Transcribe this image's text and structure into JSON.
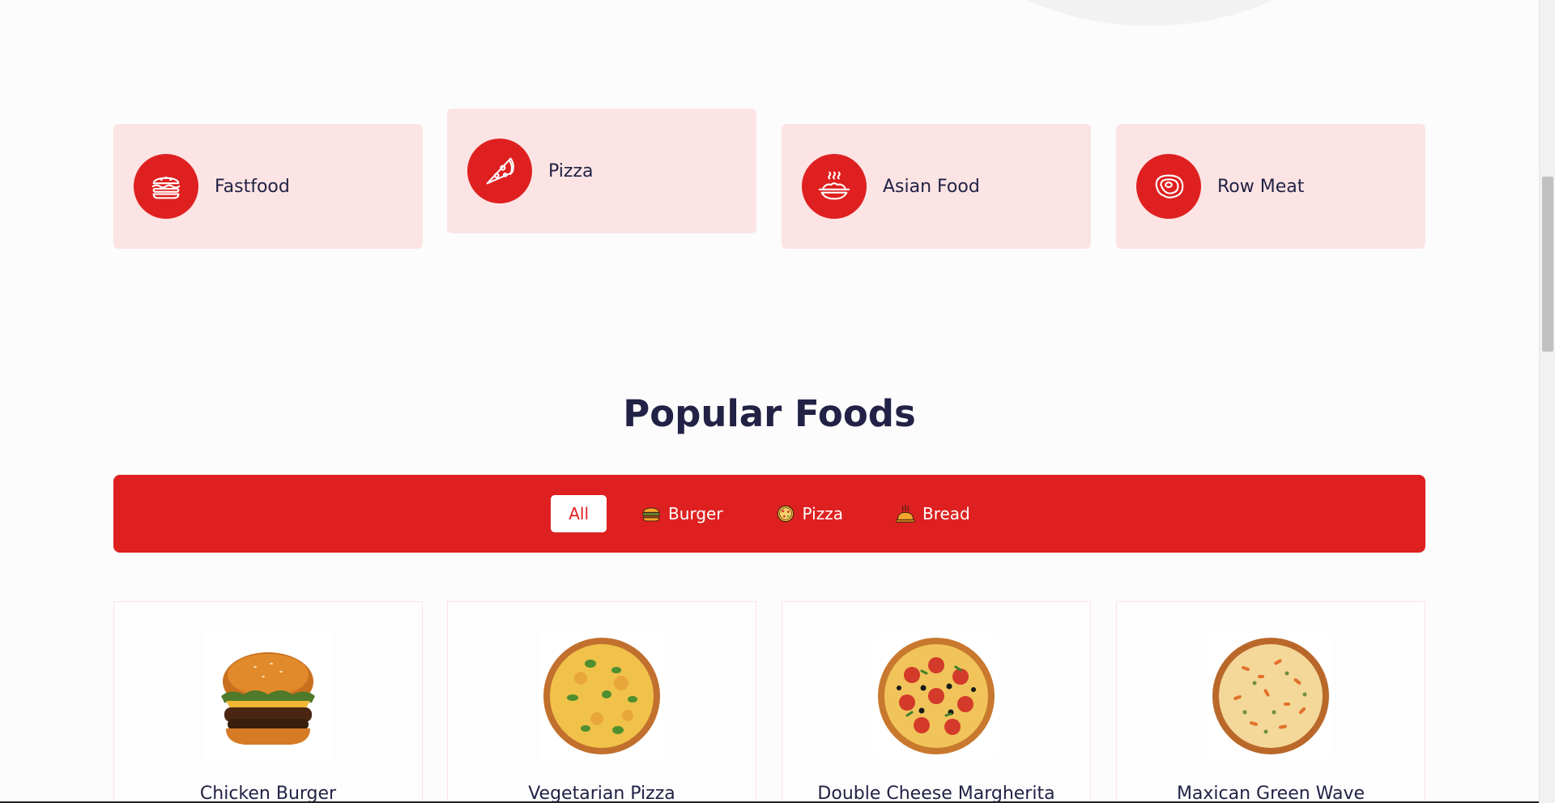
{
  "categories": [
    {
      "label": "Fastfood",
      "icon": "burger-icon"
    },
    {
      "label": "Pizza",
      "icon": "pizza-slice-icon"
    },
    {
      "label": "Asian Food",
      "icon": "noodle-bowl-icon"
    },
    {
      "label": "Row Meat",
      "icon": "steak-icon"
    }
  ],
  "popular": {
    "title": "Popular Foods"
  },
  "filters": [
    {
      "label": "All",
      "active": true
    },
    {
      "label": "Burger",
      "icon": "burger-icon"
    },
    {
      "label": "Pizza",
      "icon": "pizza-icon"
    },
    {
      "label": "Bread",
      "icon": "bread-icon"
    }
  ],
  "products": [
    {
      "name": "Chicken Burger"
    },
    {
      "name": "Vegetarian Pizza"
    },
    {
      "name": "Double Cheese Margherita"
    },
    {
      "name": "Maxican Green Wave"
    }
  ],
  "colors": {
    "accent": "#df2020",
    "card_bg": "#fde4e4",
    "heading": "#212245"
  }
}
